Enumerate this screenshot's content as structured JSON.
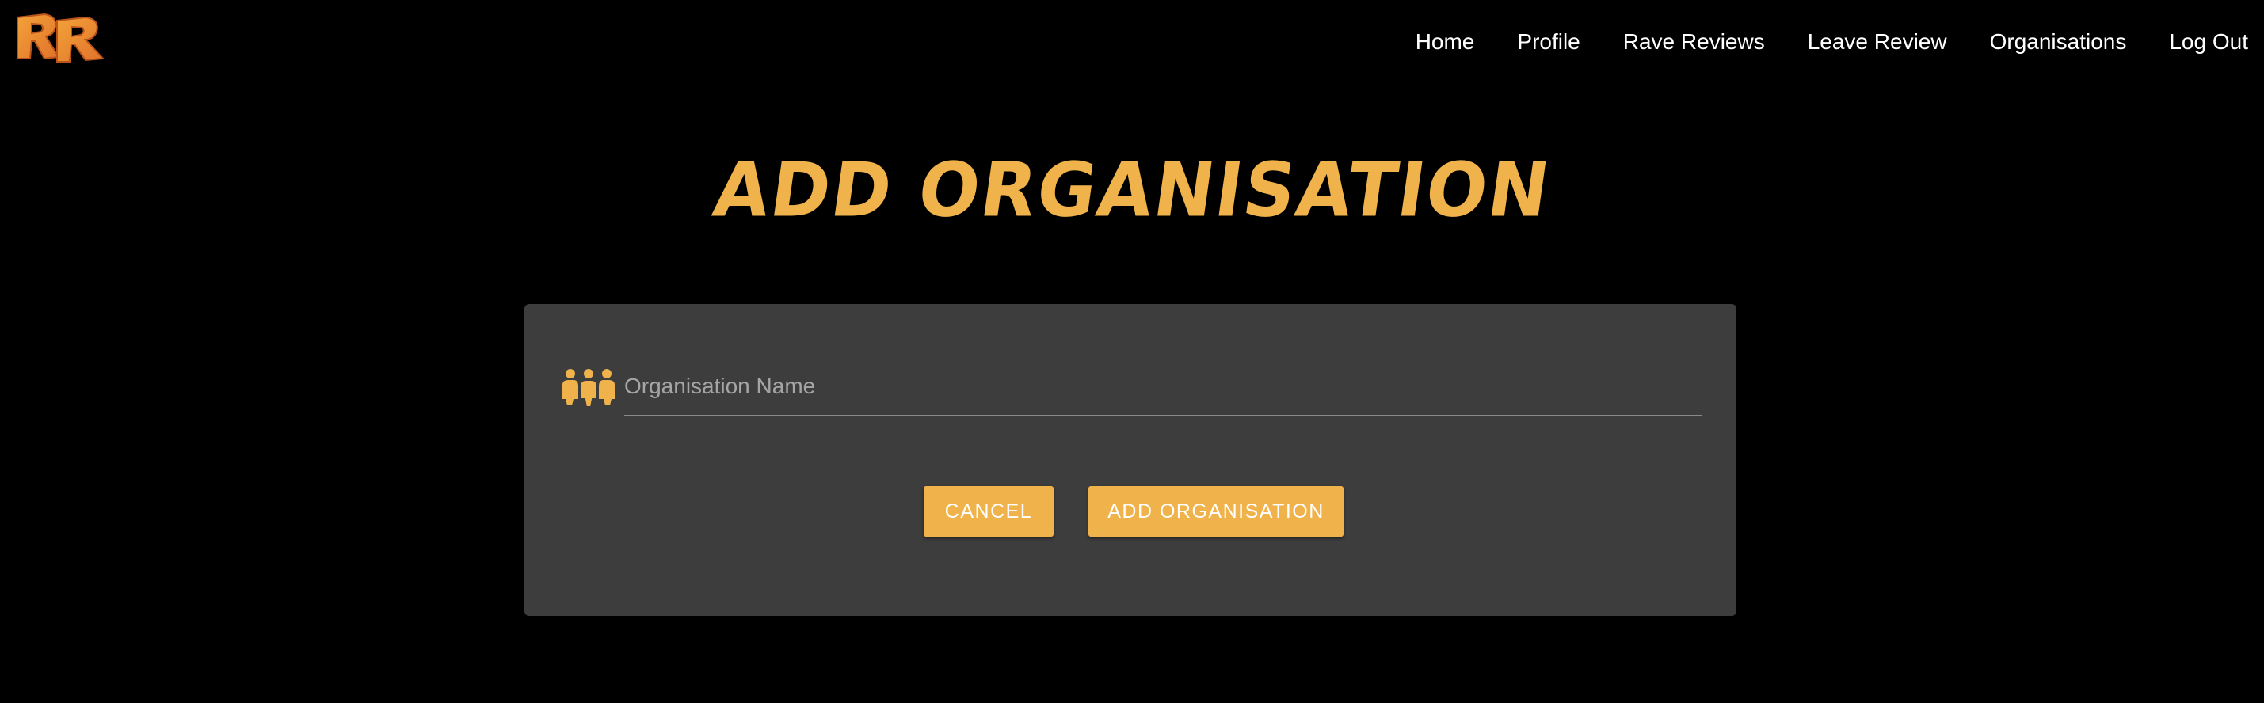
{
  "app": {
    "logo_text": "RR"
  },
  "nav": {
    "items": [
      {
        "label": "Home"
      },
      {
        "label": "Profile"
      },
      {
        "label": "Rave Reviews"
      },
      {
        "label": "Leave Review"
      },
      {
        "label": "Organisations"
      },
      {
        "label": "Log Out"
      }
    ]
  },
  "page": {
    "title": "ADD ORGANISATION"
  },
  "form": {
    "icon": "people-group-icon",
    "name_field": {
      "placeholder": "Organisation Name",
      "value": ""
    },
    "cancel_label": "CANCEL",
    "submit_label": "ADD ORGANISATION"
  },
  "colors": {
    "accent": "#f0b34b",
    "background": "#000000",
    "card": "#3d3d3d",
    "nav_text": "#ffffff"
  }
}
